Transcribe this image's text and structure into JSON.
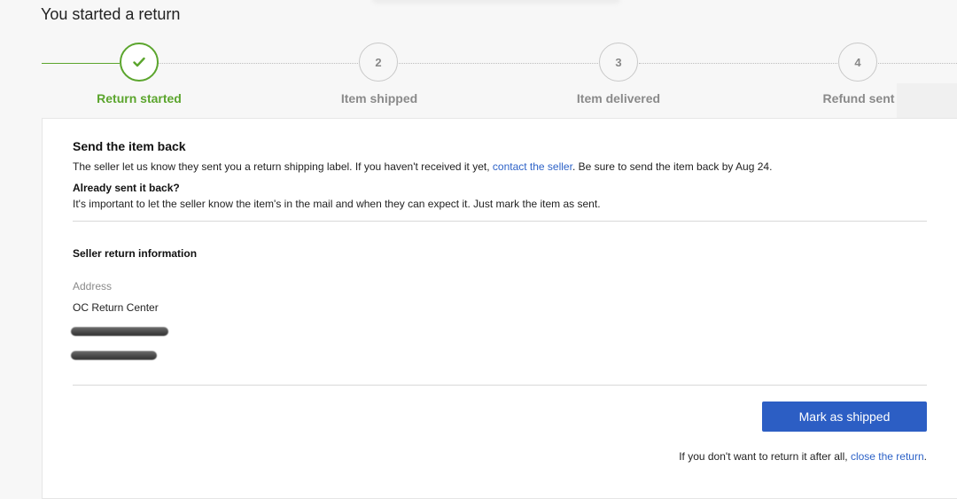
{
  "page": {
    "title": "You started a return"
  },
  "steps": [
    {
      "number": "",
      "label": "Return started",
      "status": "complete",
      "icon": "checkmark-icon"
    },
    {
      "number": "2",
      "label": "Item shipped",
      "status": "pending"
    },
    {
      "number": "3",
      "label": "Item delivered",
      "status": "pending"
    },
    {
      "number": "4",
      "label": "Refund sent",
      "status": "pending"
    }
  ],
  "send_back": {
    "title": "Send the item back",
    "text_before": "The seller let us know they sent you a return shipping label. If you haven't received it yet, ",
    "link": "contact the seller",
    "text_after": ". Be sure to send the item back by Aug 24.",
    "already_title": "Already sent it back?",
    "already_text": "It's important to let the seller know the item's in the mail and when they can expect it. Just mark the item as sent."
  },
  "seller_info": {
    "title": "Seller return information",
    "address_label": "Address",
    "address_line1": "OC Return Center"
  },
  "actions": {
    "mark_shipped": "Mark as shipped",
    "close_text": "If you don't want to return it after all, ",
    "close_link": "close the return",
    "close_end": "."
  },
  "colors": {
    "accent_green": "#5ba52d",
    "primary_blue": "#2c5ec4",
    "link_blue": "#2d62c7"
  }
}
